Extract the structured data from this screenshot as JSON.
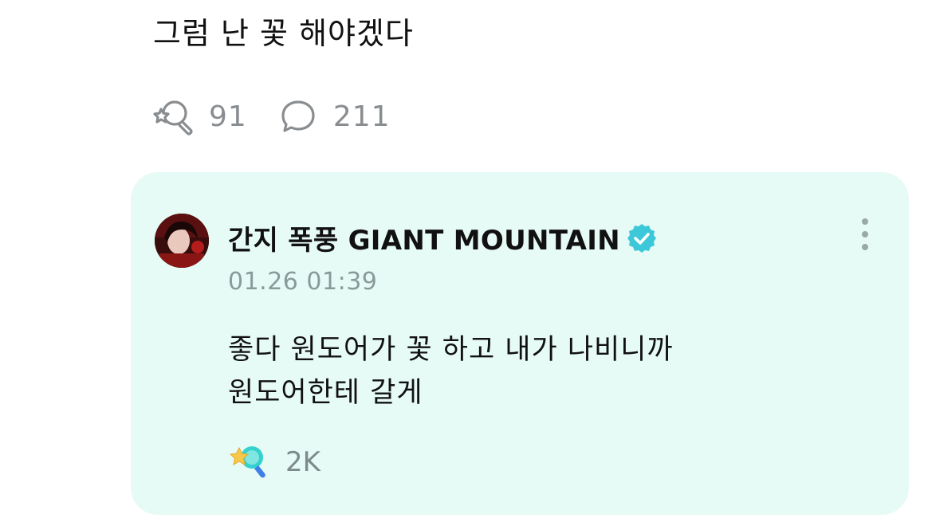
{
  "post": {
    "text": "그럼 난 꽃 해야겠다",
    "reaction_icon": "flower-reaction-icon",
    "reaction_count": "91",
    "comment_icon": "comment-bubble-icon",
    "comment_count": "211"
  },
  "reply": {
    "author_name": "간지 폭풍 GIANT MOUNTAIN",
    "verified_icon": "verified-badge-icon",
    "timestamp": "01.26 01:39",
    "text_lines": [
      "좋다 원도어가 꽃 하고 내가 나비니까",
      "원도어한테 갈게"
    ],
    "reaction_icon": "star-flower-reaction-icon",
    "reaction_count": "2K",
    "more_icon": "more-vertical-icon"
  },
  "colors": {
    "card_background": "#e7fbf6",
    "verified_badge": "#3cc8d8",
    "muted_text": "#8a8d90"
  }
}
